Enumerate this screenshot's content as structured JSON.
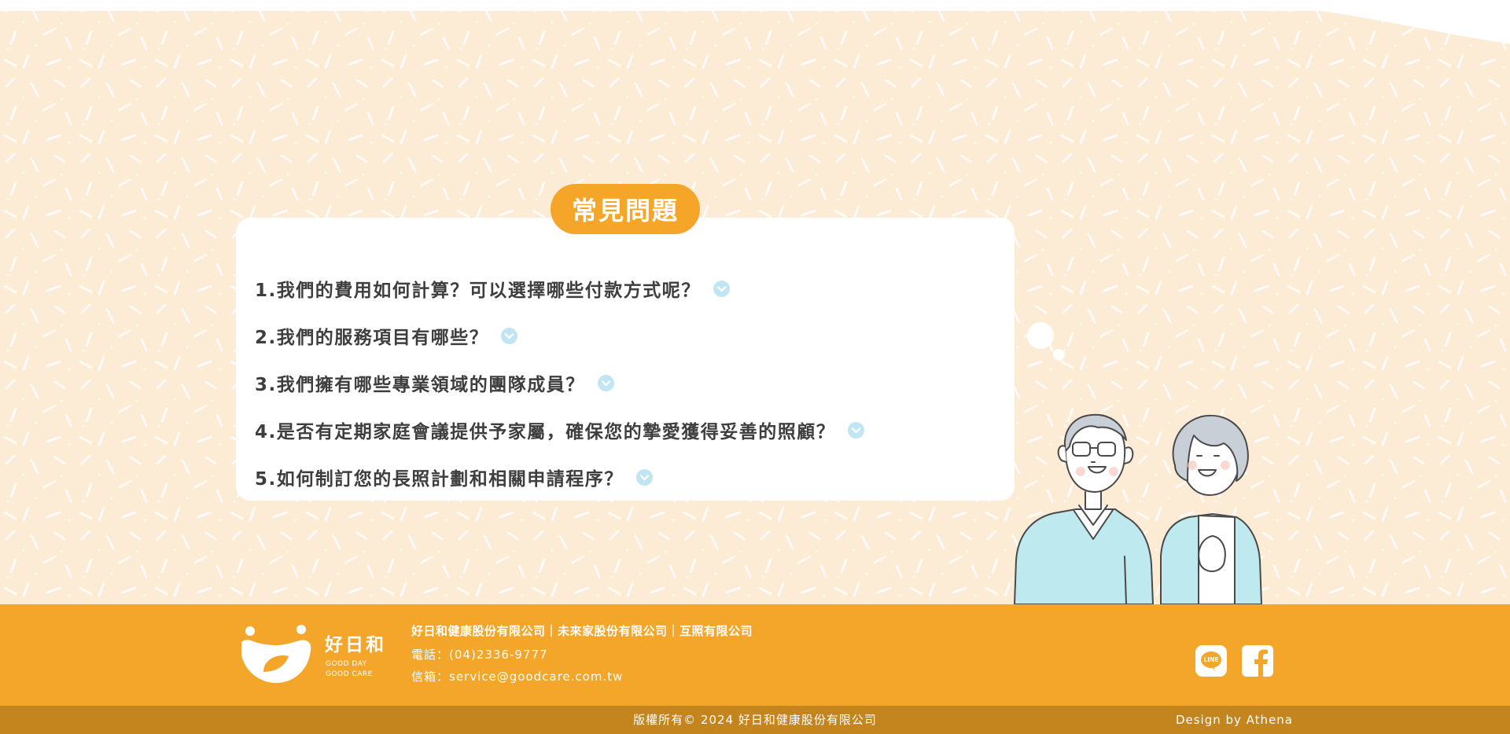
{
  "faq": {
    "title": "常見問題",
    "items": [
      {
        "question": "1.我們的費用如何計算？可以選擇哪些付款方式呢？"
      },
      {
        "question": "2.我們的服務項目有哪些？"
      },
      {
        "question": "3.我們擁有哪些專業領域的團隊成員？"
      },
      {
        "question": "4.是否有定期家庭會議提供予家屬，確保您的摯愛獲得妥善的照顧？"
      },
      {
        "question": "5.如何制訂您的長照計劃和相關申請程序？"
      }
    ],
    "expand_icon": "chevron-down-icon"
  },
  "footer": {
    "logo": {
      "name": "好日和",
      "tagline_1": "GOOD DAY",
      "tagline_2": "GOOD CARE"
    },
    "companies": "好日和健康股份有限公司｜未來家股份有限公司｜互照有限公司",
    "phone": "電話：(04)2336-9777",
    "email": "信箱：service@goodcare.com.tw",
    "social": [
      {
        "name": "LINE",
        "icon": "line-icon"
      },
      {
        "name": "Facebook",
        "icon": "facebook-icon"
      }
    ],
    "copyright": "版權所有© 2024 好日和健康股份有限公司",
    "design_by": "Design by Athena"
  },
  "colors": {
    "brand_orange": "#f4a62a",
    "background_cream": "#fcecd6",
    "copyright_bar": "#c4851f",
    "chevron_blue": "#bfe6f2",
    "question_text": "#3e3e3e"
  }
}
